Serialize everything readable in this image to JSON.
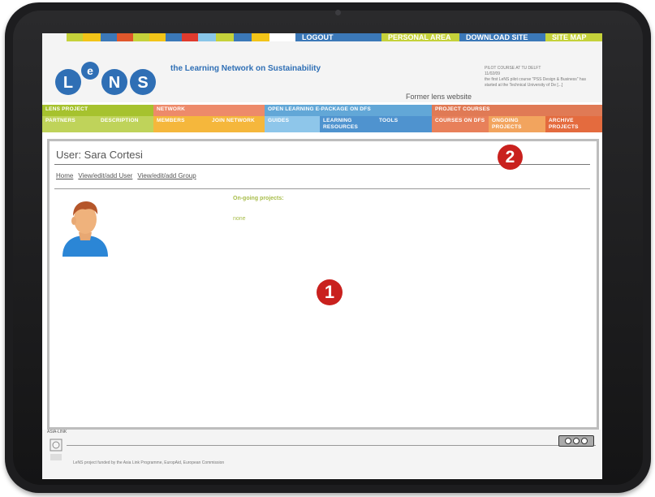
{
  "colors": {
    "topbar_segments": [
      "#c5d23a",
      "#f2c418",
      "#3b78b8",
      "#e0572b",
      "#c5d23a",
      "#3b78b8",
      "#e03a2d",
      "#89c6e8",
      "#c5d23a",
      "#3b78b8",
      "#f2c418"
    ],
    "menu_lens": "#a6c22e",
    "menu_network": "#ed8a6a",
    "menu_open": "#62a7d7",
    "menu_courses": "#e07a55",
    "callout": "#c9211e"
  },
  "topnav": {
    "logout": "LOGOUT",
    "personal": "PERSONAL AREA",
    "download": "DOWNLOAD SITE",
    "sitemap": "SITE MAP"
  },
  "header": {
    "tagline": "the Learning Network on Sustainability",
    "former": "Former lens website",
    "pilot_title": "PILOT COURSE AT TU DELFT",
    "pilot_date": "11/02/09",
    "pilot_text": "the first LeNS pilot course \"PSS Design & Business\" has started at the Technical University of De [...]"
  },
  "menu": {
    "lens_project": "LENS PROJECT",
    "partners": "PARTNERS",
    "description": "DESCRIPTION",
    "network": "NETWORK",
    "members": "MEMBERS",
    "join_network": "JOIN NETWORK",
    "open_learning": "OPEN LEARNING E-PACKAGE ON DFS",
    "guides": "GUIDES",
    "learning_resources": "LEARNING RESOURCES",
    "tools": "TOOLS",
    "project_courses": "PROJECT COURSES",
    "courses_on_dfs": "COURSES ON DFS",
    "ongoing_projects": "ONGOING PROJECTS",
    "archive_projects": "ARCHIVE PROJECTS"
  },
  "content": {
    "user_title": "User: Sara Cortesi",
    "breadcrumb": [
      "Home",
      "View/edit/add User",
      "View/edit/add Group"
    ],
    "ongoing_label": "On-going projects:",
    "ongoing_value": "none"
  },
  "footer": {
    "asia_link": "ASIA-LINK",
    "text": "LeNS project funded by the Asia Link Programme, EuropAid, European Commission"
  },
  "callouts": [
    "1",
    "2"
  ]
}
